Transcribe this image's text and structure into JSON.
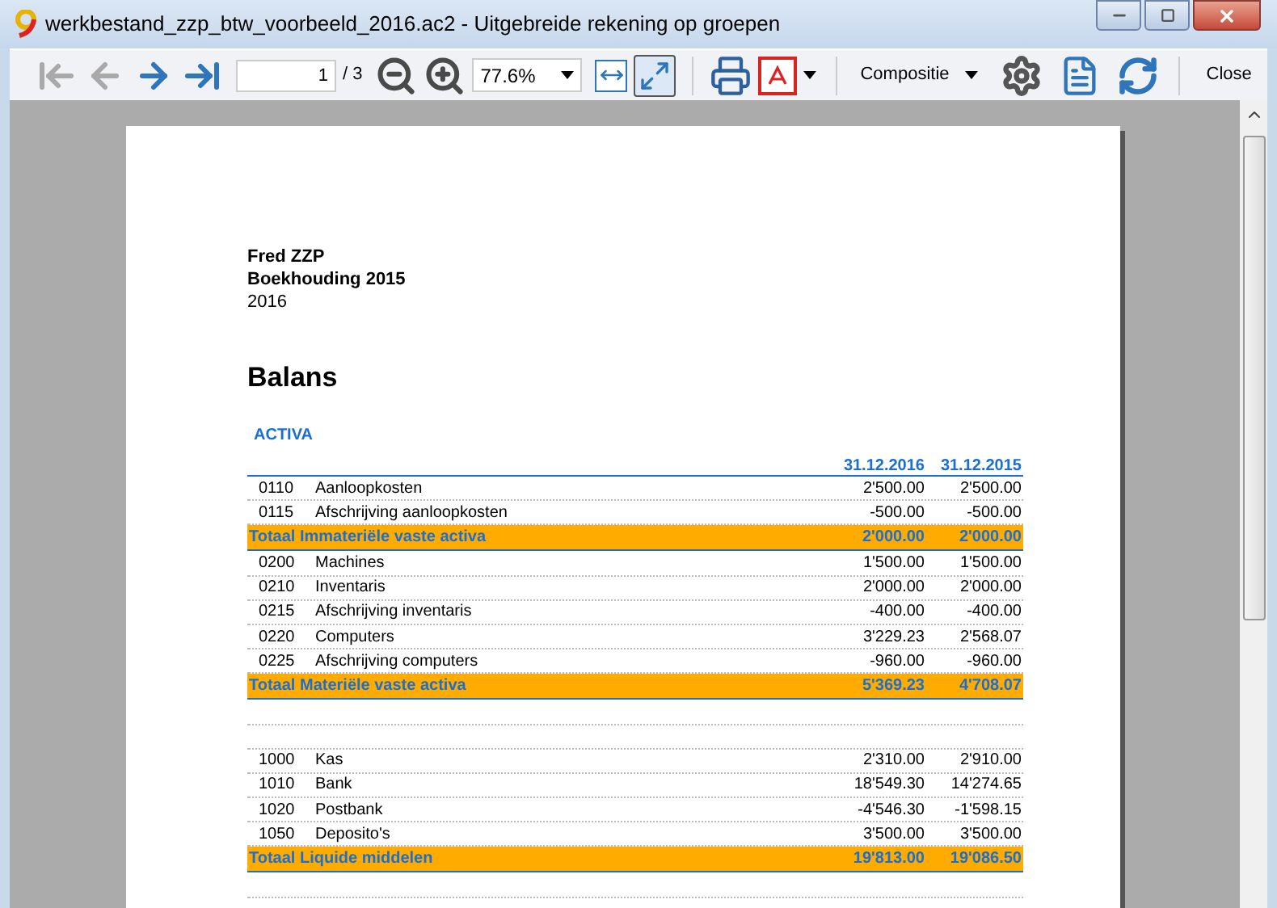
{
  "window": {
    "title": "werkbestand_zzp_btw_voorbeeld_2016.ac2 - Uitgebreide rekening op groepen"
  },
  "toolbar": {
    "nav": [
      {
        "kind": "first",
        "disabled": true
      },
      {
        "kind": "prev",
        "disabled": true
      },
      {
        "kind": "next",
        "disabled": false
      },
      {
        "kind": "last",
        "disabled": false
      }
    ],
    "page": "1",
    "page_count": "/ 3",
    "zoom": "77.6%",
    "fit_page": {
      "selected": true
    },
    "layout": "Compositie",
    "close": "Close"
  },
  "report": {
    "header": [
      "Fred ZZP",
      "Boekhouding 2015",
      "2016"
    ],
    "title": "Balans",
    "section": "ACTIVA",
    "columns": [
      "31.12.2016",
      "31.12.2015"
    ],
    "rows": [
      {
        "kind": "account",
        "code": "0110",
        "name": "Aanloopkosten",
        "values": [
          "2'500.00",
          "2'500.00"
        ]
      },
      {
        "kind": "account",
        "code": "0115",
        "name": "Afschrijving aanloopkosten",
        "values": [
          "-500.00",
          "-500.00"
        ]
      },
      {
        "kind": "total",
        "name": "Totaal Immateriële vaste activa",
        "values": [
          "2'000.00",
          "2'000.00"
        ]
      },
      {
        "kind": "account",
        "code": "0200",
        "name": "Machines",
        "values": [
          "1'500.00",
          "1'500.00"
        ]
      },
      {
        "kind": "account",
        "code": "0210",
        "name": "Inventaris",
        "values": [
          "2'000.00",
          "2'000.00"
        ]
      },
      {
        "kind": "account",
        "code": "0215",
        "name": "Afschrijving inventaris",
        "values": [
          "-400.00",
          "-400.00"
        ]
      },
      {
        "kind": "account",
        "code": "0220",
        "name": "Computers",
        "values": [
          "3'229.23",
          "2'568.07"
        ]
      },
      {
        "kind": "account",
        "code": "0225",
        "name": "Afschrijving computers",
        "values": [
          "-960.00",
          "-960.00"
        ]
      },
      {
        "kind": "total",
        "name": "Totaal Materiële vaste activa",
        "values": [
          "5'369.23",
          "4'708.07"
        ]
      },
      {
        "kind": "blank"
      },
      {
        "kind": "blank"
      },
      {
        "kind": "account",
        "code": "1000",
        "name": "Kas",
        "values": [
          "2'310.00",
          "2'910.00"
        ]
      },
      {
        "kind": "account",
        "code": "1010",
        "name": "Bank",
        "values": [
          "18'549.30",
          "14'274.65"
        ]
      },
      {
        "kind": "account",
        "code": "1020",
        "name": "Postbank",
        "values": [
          "-4'546.30",
          "-1'598.15"
        ]
      },
      {
        "kind": "account",
        "code": "1050",
        "name": "Deposito's",
        "values": [
          "3'500.00",
          "3'500.00"
        ]
      },
      {
        "kind": "total",
        "name": "Totaal Liquide middelen",
        "values": [
          "19'813.00",
          "19'086.50"
        ]
      },
      {
        "kind": "blank"
      }
    ]
  }
}
